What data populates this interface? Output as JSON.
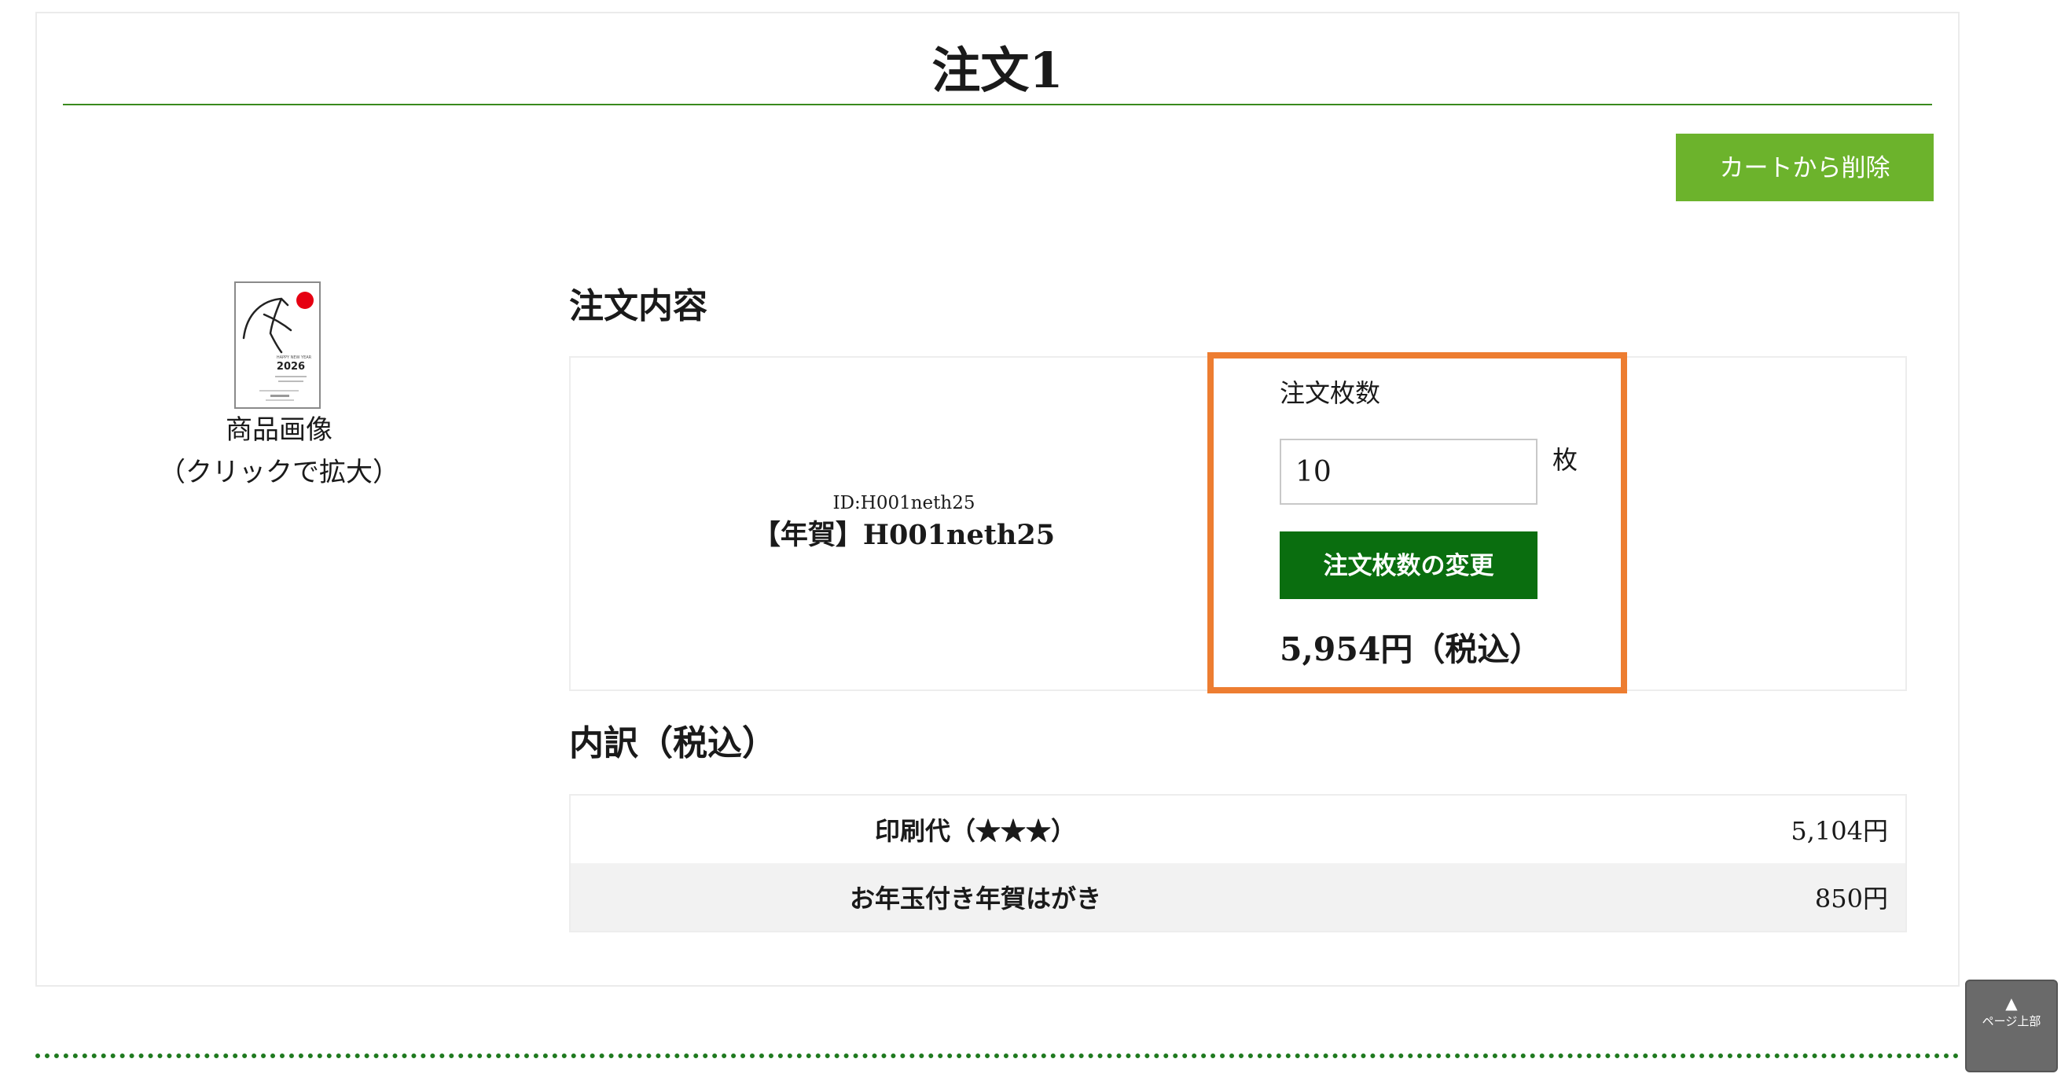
{
  "header": {
    "title": "注文1"
  },
  "actions": {
    "remove_from_cart": "カートから削除"
  },
  "product_image": {
    "caption_line1": "商品画像",
    "caption_line2": "（クリックで拡大）",
    "card_year": "2026"
  },
  "order_content": {
    "heading": "注文内容",
    "product_id": "ID:H001neth25",
    "product_name": "【年賀】H001neth25",
    "quantity_label": "注文枚数",
    "quantity_value": "10",
    "quantity_unit": "枚",
    "change_quantity_button": "注文枚数の変更",
    "total": "5,954円（税込）"
  },
  "breakdown": {
    "heading": "内訳（税込）",
    "rows": [
      {
        "item": "印刷代（★★★）",
        "price": "5,104円"
      },
      {
        "item": "お年玉付き年賀はがき",
        "price": "850円"
      }
    ]
  },
  "page_top": {
    "arrow": "▲",
    "label": "ページ上部"
  },
  "colors": {
    "remove_button": "#6cb32c",
    "change_button": "#0a6e0f",
    "highlight_border": "#ed7d31",
    "title_rule": "#3a8a1e"
  }
}
